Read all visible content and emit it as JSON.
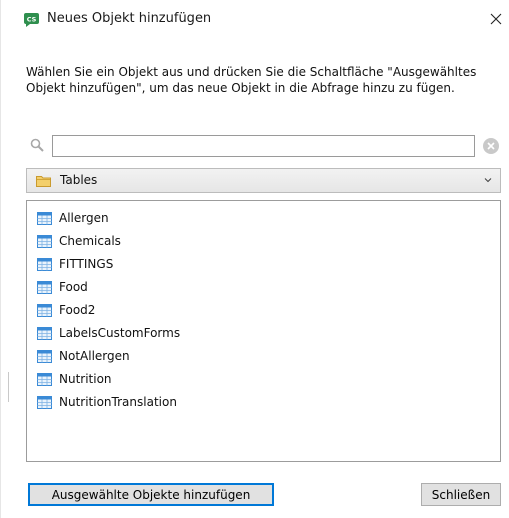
{
  "window": {
    "title": "Neues Objekt hinzufügen",
    "app_icon_text": "CS"
  },
  "description": "Wählen Sie ein Objekt aus und drücken Sie die Schaltfläche \"Ausgewähltes Objekt hinzufügen\", um das neue Objekt in die Abfrage hinzu zu fügen.",
  "search": {
    "value": "",
    "placeholder": ""
  },
  "category_dropdown": {
    "selected": "Tables"
  },
  "items": [
    {
      "label": "Allergen"
    },
    {
      "label": "Chemicals"
    },
    {
      "label": "FITTINGS"
    },
    {
      "label": "Food"
    },
    {
      "label": "Food2"
    },
    {
      "label": "LabelsCustomForms"
    },
    {
      "label": "NotAllergen"
    },
    {
      "label": "Nutrition"
    },
    {
      "label": "NutritionTranslation"
    }
  ],
  "buttons": {
    "add_label": "Ausgewählte Objekte hinzufügen",
    "close_label": "Schließen"
  },
  "colors": {
    "accent": "#0078d7",
    "folder": "#e8b94a",
    "table_icon": "#3a8ad6"
  },
  "icons": {
    "app": "app-logo-icon",
    "close": "close-icon",
    "search": "search-icon",
    "clear": "clear-icon",
    "folder": "folder-icon",
    "chevron": "chevron-down-icon",
    "table": "table-icon"
  }
}
